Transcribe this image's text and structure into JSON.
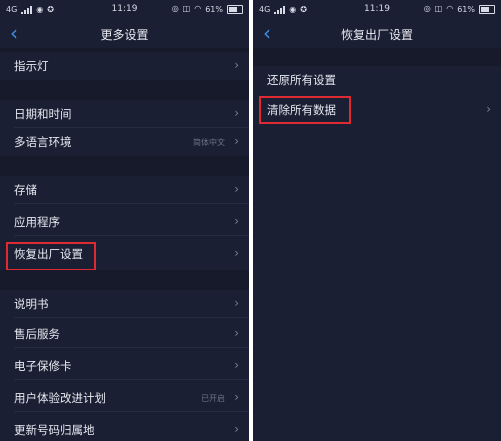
{
  "status_bar": {
    "network": "4G",
    "time": "11:19",
    "battery_percent": "61%"
  },
  "left_screen": {
    "title": "更多设置",
    "items": [
      {
        "label": "指示灯",
        "value": ""
      },
      {
        "label": "日期和时间",
        "value": ""
      },
      {
        "label": "多语言环境",
        "value": "简体中文"
      },
      {
        "label": "存储",
        "value": ""
      },
      {
        "label": "应用程序",
        "value": ""
      },
      {
        "label": "恢复出厂设置",
        "value": ""
      },
      {
        "label": "说明书",
        "value": ""
      },
      {
        "label": "售后服务",
        "value": ""
      },
      {
        "label": "电子保修卡",
        "value": ""
      },
      {
        "label": "用户体验改进计划",
        "value": "已开启"
      },
      {
        "label": "更新号码归属地",
        "value": ""
      }
    ]
  },
  "right_screen": {
    "title": "恢复出厂设置",
    "items": [
      {
        "label": "还原所有设置"
      },
      {
        "label": "清除所有数据"
      }
    ]
  },
  "colors": {
    "background": "#1b1f33",
    "accent": "#3f8fe6",
    "highlight": "#e02a32"
  },
  "icons": {
    "back": "chevron-left-icon",
    "item": "chevron-right-icon"
  }
}
